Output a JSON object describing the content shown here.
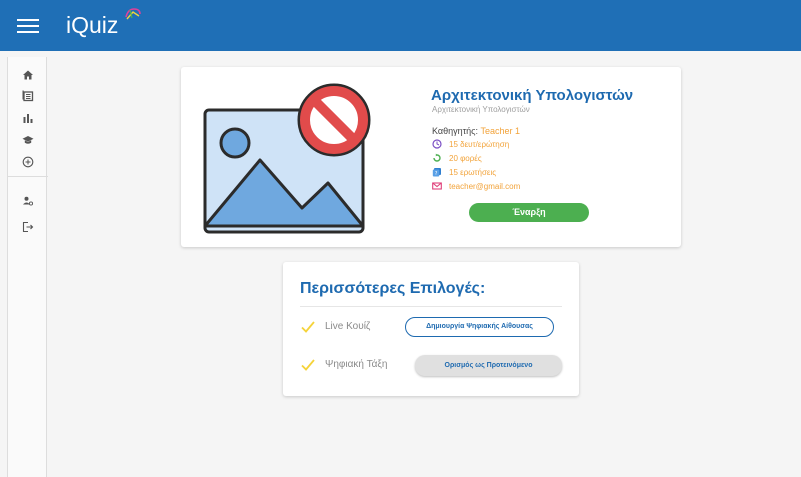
{
  "app": {
    "logo_text": "iQuiz"
  },
  "sidebar": {
    "items": [
      {
        "icon": "home-icon"
      },
      {
        "icon": "list-icon"
      },
      {
        "icon": "bar-chart-icon"
      },
      {
        "icon": "graduation-cap-icon"
      },
      {
        "icon": "add-circle-icon"
      },
      {
        "icon": "users-icon"
      },
      {
        "icon": "logout-icon"
      }
    ]
  },
  "quiz": {
    "title": "Αρχιτεκτονική Υπολογιστών",
    "subtitle": "Αρχιτεκτονική Υπολογιστών",
    "teacher_label": "Καθηγητής: ",
    "teacher_name": "Teacher 1",
    "time_per_question": "15 δευτ/ερώτηση",
    "attempts": "20 φορές",
    "questions": "15 ερωτήσεις",
    "email": "teacher@gmail.com",
    "start_label": "Έναρξη"
  },
  "options": {
    "title": "Περισσότερες Επιλογές:",
    "items": [
      {
        "label": "Live Κουίζ",
        "button": "Δημιουργία Ψηφιακής Αίθουσας"
      },
      {
        "label": "Ψηφιακή Τάξη",
        "button": "Ορισμός ως Προτεινόμενο"
      }
    ]
  },
  "colors": {
    "topbar": "#1f6fb6",
    "accent_blue": "#1e6ab0",
    "accent_orange": "#f2a33a",
    "start_green": "#4caf50",
    "check_yellow": "#f5d33a"
  }
}
